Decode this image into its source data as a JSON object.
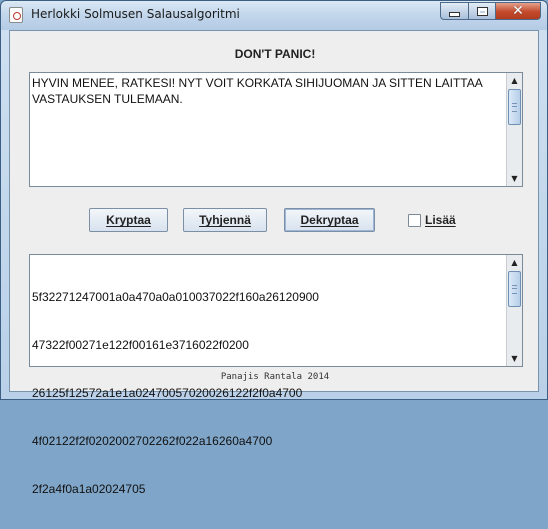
{
  "window": {
    "title": "Herlokki Solmusen Salausalgoritmi"
  },
  "heading": "DON'T PANIC!",
  "message_area": {
    "text": "HYVIN MENEE, RATKESI! NYT VOIT KORKATA SIHIJUOMAN JA SITTEN LAITTAA\nVASTAUKSEN TULEMAAN."
  },
  "buttons": {
    "encrypt": "Kryptaa",
    "clear": "Tyhjennä",
    "decrypt": "Dekryptaa"
  },
  "checkbox": {
    "label": "Lisää",
    "checked": false
  },
  "cipher_area": {
    "lines": [
      "5f32271247001a0a470a0a010037022f160a26120900",
      "47322f00271e122f00161e3716022f0200",
      "26125f12572a1e1a02470057020026122f2f0a4700",
      "4f02122f2f0202002702262f022a16260a4700",
      "2f2a4f0a1a02024705"
    ]
  },
  "footer": "Panajis Rantala 2014",
  "icons": {
    "app": "java-cup-icon",
    "minimize": "minimize-icon",
    "maximize": "maximize-icon",
    "close": "close-icon",
    "scroll_up": "arrow-up-icon",
    "scroll_down": "arrow-down-icon"
  },
  "colors": {
    "close_button": "#c34a2c",
    "titlebar": "#c3d7ec"
  }
}
